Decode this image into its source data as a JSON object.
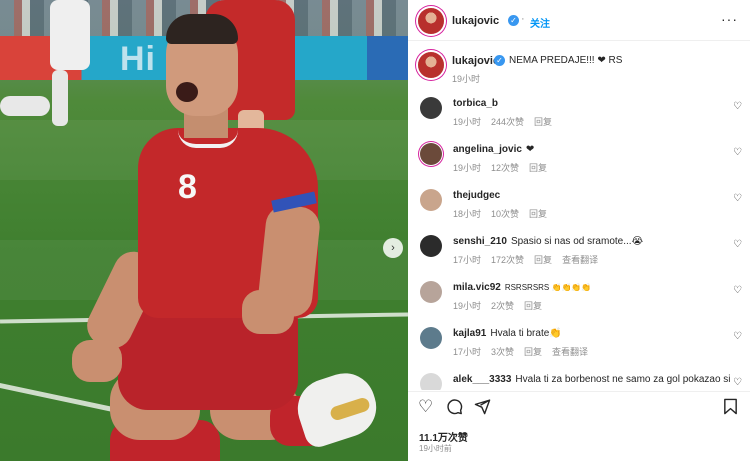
{
  "post": {
    "author": "lukajovic",
    "follow_label": "关注",
    "more_label": "···",
    "caption": {
      "username": "lukajovic",
      "text": "NEMA PREDAJE!!! ❤ RS",
      "time": "19小时"
    },
    "photo": {
      "board_text": "Hi  ee",
      "jersey_number": "8",
      "next_label": "›"
    }
  },
  "comments": [
    {
      "username": "torbica_b",
      "text": "",
      "time": "19小时",
      "likes": "244次赞",
      "reply": "回复",
      "translate": "",
      "avatar_color": "#3a3a3a"
    },
    {
      "username": "angelina_jovic",
      "text": "❤",
      "time": "19小时",
      "likes": "12次赞",
      "reply": "回复",
      "translate": "",
      "avatar_color": "#6b4a3a"
    },
    {
      "username": "thejudgec",
      "text": "",
      "time": "18小时",
      "likes": "10次赞",
      "reply": "回复",
      "translate": "",
      "avatar_color": "#c9a58c"
    },
    {
      "username": "senshi_210",
      "text": "Spasio si nas od sramote...😭",
      "time": "17小时",
      "likes": "172次赞",
      "reply": "回复",
      "translate": "查看翻译",
      "avatar_color": "#2b2b2b"
    },
    {
      "username": "mila.vic92",
      "text": "RSRSRSRS 👏👏👏👏",
      "time": "19小时",
      "likes": "2次赞",
      "reply": "回复",
      "translate": "",
      "avatar_color": "#b7a49a"
    },
    {
      "username": "kajla91",
      "text": "Hvala ti brate👏",
      "time": "17小时",
      "likes": "3次赞",
      "reply": "回复",
      "translate": "查看翻译",
      "avatar_color": "#5d7b8c"
    },
    {
      "username": "alek___3333",
      "text": "Hvala ti za borbenost ne samo za gol pokazao si",
      "time": "",
      "likes": "",
      "reply": "",
      "translate": "",
      "avatar_color": "#d9d9d9"
    }
  ],
  "actions": {
    "like_icon": "heart-outline",
    "comment_icon": "speech-bubble",
    "share_icon": "paper-plane",
    "save_icon": "bookmark",
    "likes_count": "11.1万次赞",
    "posted_ago": "19小时前"
  },
  "colors": {
    "accent_blue": "#0095f6",
    "verified_blue": "#3897f0",
    "red_heart": "#ed4956",
    "muted_text": "#8e8e8e"
  }
}
